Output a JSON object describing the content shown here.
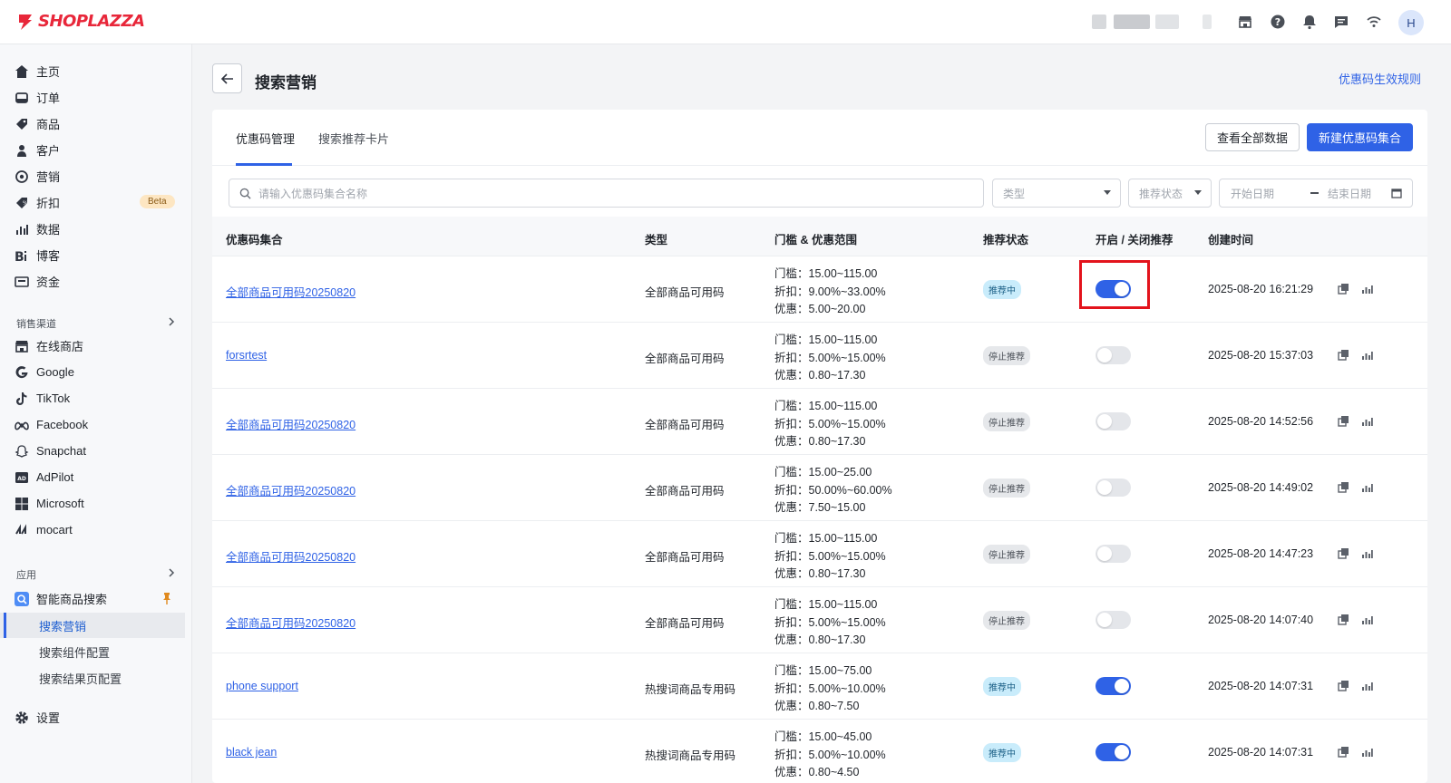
{
  "topbar": {
    "logo_text": "SHOPLAZZA",
    "avatar_letter": "H",
    "icons": [
      "store-icon",
      "help-icon",
      "bell-icon",
      "message-icon",
      "wifi-icon"
    ]
  },
  "sidebar": {
    "main_items": [
      {
        "label": "主页",
        "icon": "home-icon"
      },
      {
        "label": "订单",
        "icon": "order-icon"
      },
      {
        "label": "商品",
        "icon": "tag-icon"
      },
      {
        "label": "客户",
        "icon": "user-icon"
      },
      {
        "label": "营销",
        "icon": "target-icon"
      },
      {
        "label": "折扣",
        "icon": "discount-icon",
        "badge": "Beta"
      },
      {
        "label": "数据",
        "icon": "bar-chart-icon"
      },
      {
        "label": "博客",
        "icon": "blog-icon"
      },
      {
        "label": "资金",
        "icon": "wallet-icon"
      }
    ],
    "channels_title": "销售渠道",
    "channels": [
      {
        "label": "在线商店",
        "icon": "store-icon"
      },
      {
        "label": "Google",
        "icon": "google-icon"
      },
      {
        "label": "TikTok",
        "icon": "tiktok-icon"
      },
      {
        "label": "Facebook",
        "icon": "meta-icon"
      },
      {
        "label": "Snapchat",
        "icon": "snapchat-icon"
      },
      {
        "label": "AdPilot",
        "icon": "adpilot-icon"
      },
      {
        "label": "Microsoft",
        "icon": "microsoft-icon"
      },
      {
        "label": "mocart",
        "icon": "mocart-icon"
      }
    ],
    "apps_title": "应用",
    "app": {
      "label": "智能商品搜索",
      "icon": "smart-search-icon"
    },
    "app_subitems": [
      "搜索营销",
      "搜索组件配置",
      "搜索结果页配置"
    ],
    "settings_label": "设置"
  },
  "page": {
    "title": "搜索营销",
    "rule_link": "优惠码生效规则"
  },
  "tabs": [
    "优惠码管理",
    "搜索推荐卡片"
  ],
  "actions": {
    "view_all": "查看全部数据",
    "create": "新建优惠码集合"
  },
  "filters": {
    "search_placeholder": "请输入优惠码集合名称",
    "type_placeholder": "类型",
    "status_placeholder": "推荐状态",
    "start_date": "开始日期",
    "end_date": "结束日期"
  },
  "table": {
    "columns": [
      "优惠码集合",
      "类型",
      "门槛 & 优惠范围",
      "推荐状态",
      "开启 / 关闭推荐",
      "创建时间"
    ],
    "rows": [
      {
        "name": "全部商品可用码20250820",
        "type": "全部商品可用码",
        "threshold": "门槛：15.00~115.00",
        "discount": "折扣：9.00%~33.00%",
        "offer": "优惠：5.00~20.00",
        "status": "推荐中",
        "enabled": true,
        "created": "2025-08-20 16:21:29"
      },
      {
        "name": "forsrtest",
        "type": "全部商品可用码",
        "threshold": "门槛：15.00~115.00",
        "discount": "折扣：5.00%~15.00%",
        "offer": "优惠：0.80~17.30",
        "status": "停止推荐",
        "enabled": false,
        "created": "2025-08-20 15:37:03"
      },
      {
        "name": "全部商品可用码20250820",
        "type": "全部商品可用码",
        "threshold": "门槛：15.00~115.00",
        "discount": "折扣：5.00%~15.00%",
        "offer": "优惠：0.80~17.30",
        "status": "停止推荐",
        "enabled": false,
        "created": "2025-08-20 14:52:56"
      },
      {
        "name": "全部商品可用码20250820",
        "type": "全部商品可用码",
        "threshold": "门槛：15.00~25.00",
        "discount": "折扣：50.00%~60.00%",
        "offer": "优惠：7.50~15.00",
        "status": "停止推荐",
        "enabled": false,
        "created": "2025-08-20 14:49:02"
      },
      {
        "name": "全部商品可用码20250820",
        "type": "全部商品可用码",
        "threshold": "门槛：15.00~115.00",
        "discount": "折扣：5.00%~15.00%",
        "offer": "优惠：0.80~17.30",
        "status": "停止推荐",
        "enabled": false,
        "created": "2025-08-20 14:47:23"
      },
      {
        "name": "全部商品可用码20250820",
        "type": "全部商品可用码",
        "threshold": "门槛：15.00~115.00",
        "discount": "折扣：5.00%~15.00%",
        "offer": "优惠：0.80~17.30",
        "status": "停止推荐",
        "enabled": false,
        "created": "2025-08-20 14:07:40"
      },
      {
        "name": "phone support",
        "type": "热搜词商品专用码",
        "threshold": "门槛：15.00~75.00",
        "discount": "折扣：5.00%~10.00%",
        "offer": "优惠：0.80~7.50",
        "status": "推荐中",
        "enabled": true,
        "created": "2025-08-20 14:07:31"
      },
      {
        "name": "black jean",
        "type": "热搜词商品专用码",
        "threshold": "门槛：15.00~45.00",
        "discount": "折扣：5.00%~10.00%",
        "offer": "优惠：0.80~4.50",
        "status": "推荐中",
        "enabled": true,
        "created": "2025-08-20 14:07:31"
      }
    ]
  },
  "colors": {
    "primary": "#2f62e6",
    "brand": "#e8273a",
    "highlight": "#e3131c",
    "badge_on_bg": "#c9ecfb",
    "badge_off_bg": "#e6e8eb"
  }
}
